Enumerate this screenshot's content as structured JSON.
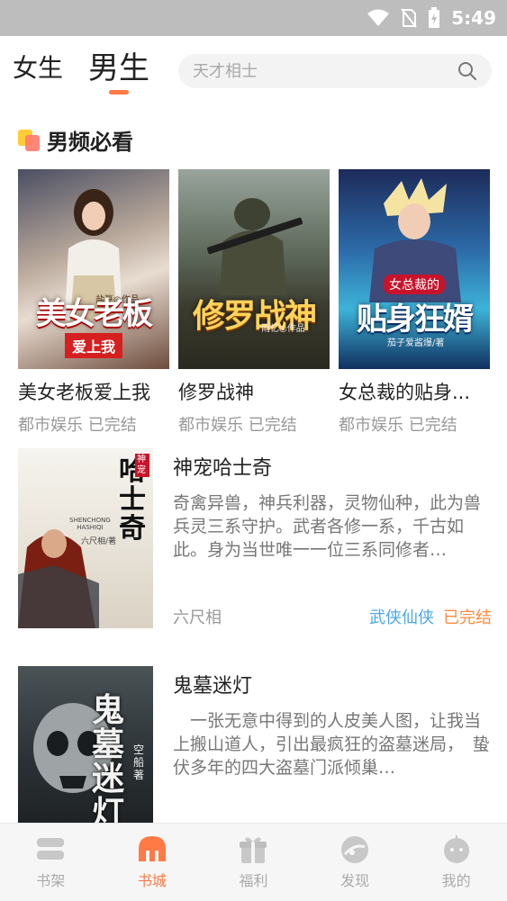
{
  "status_bar": {
    "time": "5:49"
  },
  "tabs": [
    {
      "label": "女生",
      "active": false
    },
    {
      "label": "男生",
      "active": true
    }
  ],
  "search": {
    "placeholder": "天才相士"
  },
  "section": {
    "title": "男频必看"
  },
  "featured_books": [
    {
      "title": "美女老板爱上我",
      "cover_text": "美女老板",
      "cover_subtitle": "爱上我",
      "cover_author": "盐豆◎作品",
      "genre": "都市娱乐",
      "status": "已完结"
    },
    {
      "title": "修罗战神",
      "cover_text": "修罗战神",
      "cover_author": "雨忆◎作品",
      "genre": "都市娱乐",
      "status": "已完结"
    },
    {
      "title": "女总裁的贴身...",
      "cover_text": "贴身狂婿",
      "cover_subtitle": "女总裁的",
      "cover_author": "茄子爱酱爆/著",
      "genre": "都市娱乐",
      "status": "已完结"
    }
  ],
  "list_books": [
    {
      "title": "神宠哈士奇",
      "description": "奇禽异兽，神兵利器，灵物仙种，此为兽兵灵三系守护。武者各修一系，千古如此。身为当世唯一一位三系同修者…",
      "author": "六尺相",
      "genre": "武侠仙侠",
      "status": "已完结",
      "cover_text": "哈士奇",
      "cover_subtitle": "SHENCHONG HASHIQI",
      "cover_tag": "神宠",
      "cover_author": "六尺相/著"
    },
    {
      "title": "鬼墓迷灯",
      "description": "一张无意中得到的人皮美人图，让我当上搬山道人，引出最疯狂的盗墓迷局，　蛰伏多年的四大盗墓门派倾巢…",
      "author": "",
      "genre": "",
      "status": "",
      "cover_text": "鬼墓迷灯",
      "cover_author": "空船著"
    }
  ],
  "bottom_nav": [
    {
      "label": "书架",
      "icon": "bookshelf-icon",
      "active": false
    },
    {
      "label": "书城",
      "icon": "bookstore-icon",
      "active": true
    },
    {
      "label": "福利",
      "icon": "gift-icon",
      "active": false
    },
    {
      "label": "发现",
      "icon": "discover-icon",
      "active": false
    },
    {
      "label": "我的",
      "icon": "profile-icon",
      "active": false
    }
  ],
  "colors": {
    "accent": "#ff7a45",
    "genre": "#4aa8e6",
    "status": "#ff8a3d"
  }
}
